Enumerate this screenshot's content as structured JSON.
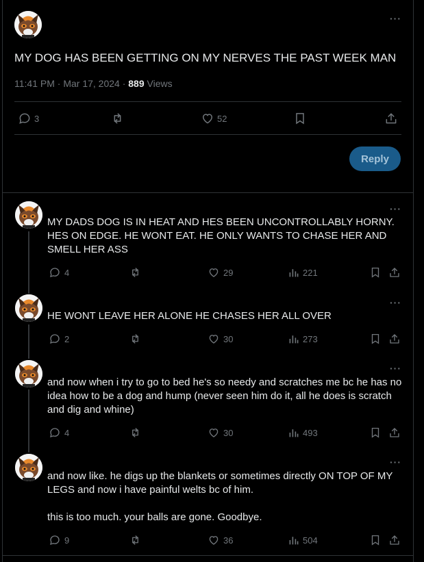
{
  "main_tweet": {
    "text": "MY DOG HAS BEEN GETTING ON MY NERVES THE PAST WEEK MAN",
    "timestamp": "11:41 PM · Mar 17, 2024 · ",
    "views_count": "889",
    "views_label": " Views",
    "replies": "3",
    "likes": "52"
  },
  "reply_button": "Reply",
  "replies": [
    {
      "text": "MY DADS DOG IS IN HEAT AND HES BEEN UNCONTROLLABLY HORNY. HES ON EDGE. HE WONT EAT. HE ONLY WANTS TO CHASE HER AND SMELL HER ASS",
      "replies": "4",
      "likes": "29",
      "views": "221"
    },
    {
      "text": "HE WONT LEAVE HER ALONE HE CHASES HER ALL OVER",
      "replies": "2",
      "likes": "30",
      "views": "273"
    },
    {
      "text": "and now when i try to go to bed he's so needy and scratches me bc he has no idea how to be a dog and hump (never seen him do it, all he does is scratch and dig and whine)",
      "replies": "4",
      "likes": "30",
      "views": "493"
    },
    {
      "text": "and now like. he digs up the blankets or sometimes directly ON TOP OF MY LEGS and now i have painful welts bc of him.\n\nthis is too much. your balls are gone. Goodbye.",
      "replies": "9",
      "likes": "36",
      "views": "504"
    }
  ],
  "colors": {
    "background": "#000000",
    "text": "#e7e9ea",
    "muted": "#71767b",
    "divider": "#2f3336",
    "reply_button": "#1a5b8a"
  },
  "icons": [
    "more-icon",
    "reply-icon",
    "retweet-icon",
    "like-icon",
    "bookmark-icon",
    "share-icon",
    "views-icon"
  ]
}
